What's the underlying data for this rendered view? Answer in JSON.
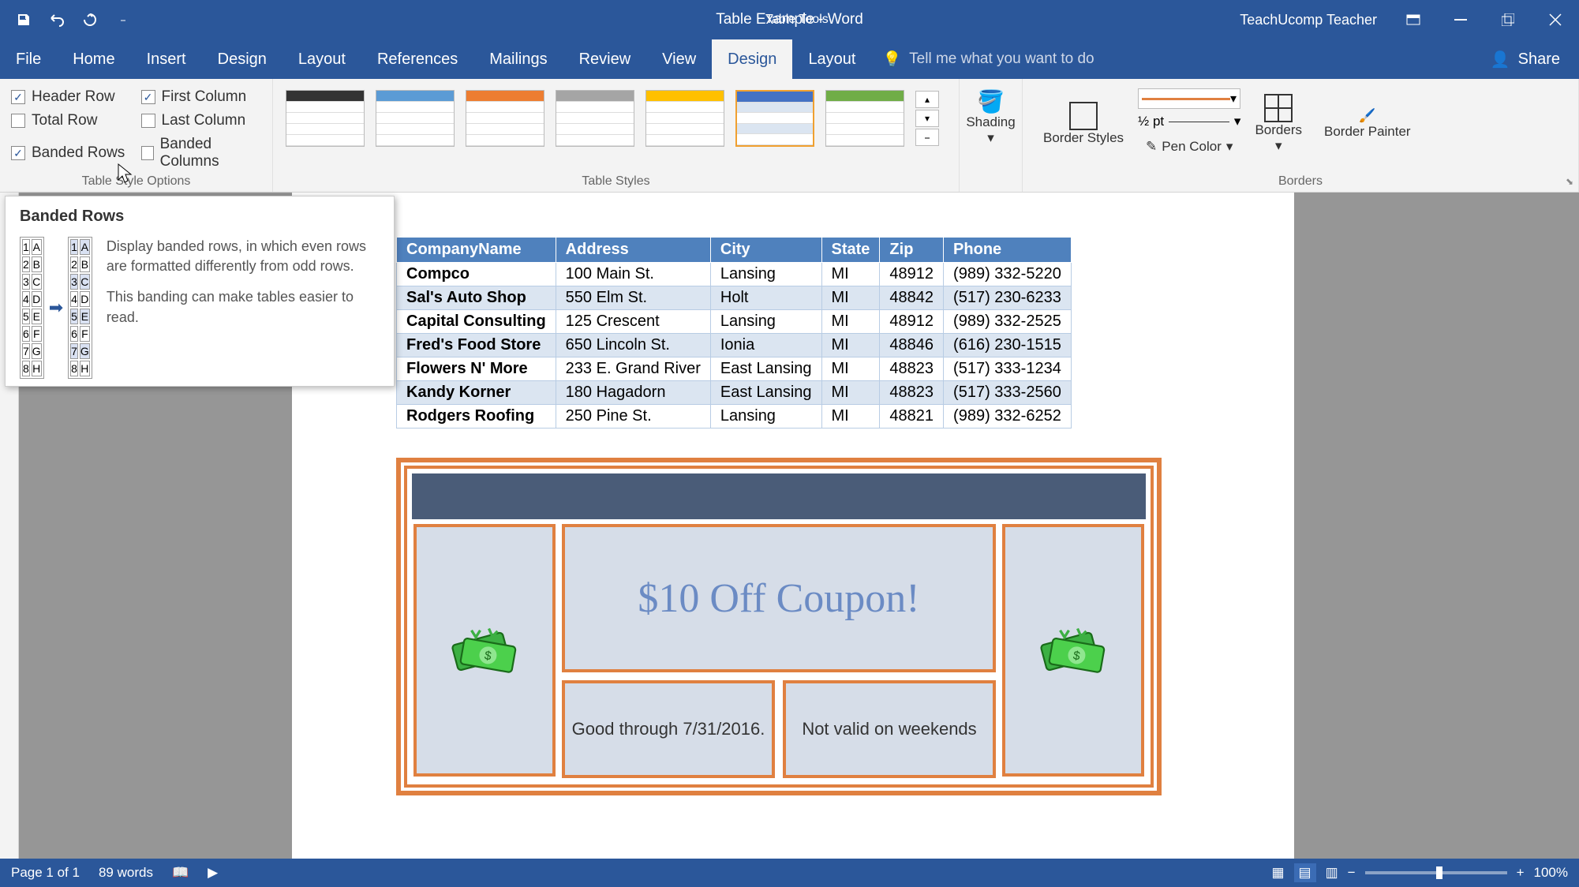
{
  "title_bar": {
    "doc_title": "Table Example - Word",
    "table_tools": "Table Tools",
    "user": "TeachUcomp Teacher"
  },
  "tabs": {
    "file": "File",
    "home": "Home",
    "insert": "Insert",
    "design1": "Design",
    "layout1": "Layout",
    "references": "References",
    "mailings": "Mailings",
    "review": "Review",
    "view": "View",
    "design2": "Design",
    "layout2": "Layout",
    "tell_me": "Tell me what you want to do",
    "share": "Share"
  },
  "ribbon": {
    "style_options": {
      "header_row": "Header Row",
      "first_column": "First Column",
      "total_row": "Total Row",
      "last_column": "Last Column",
      "banded_rows": "Banded Rows",
      "banded_columns": "Banded Columns",
      "group_label": "Table Style Options"
    },
    "table_styles_label": "Table Styles",
    "shading": "Shading",
    "border_styles": "Border Styles",
    "line_weight": "½ pt",
    "pen_color": "Pen Color",
    "borders": "Borders",
    "border_painter": "Border Painter",
    "borders_label": "Borders"
  },
  "tooltip": {
    "title": "Banded Rows",
    "p1": "Display banded rows, in which even rows are formatted differently from odd rows.",
    "p2": "This banding can make tables easier to read."
  },
  "data_table": {
    "headers": [
      "CompanyName",
      "Address",
      "City",
      "State",
      "Zip",
      "Phone"
    ],
    "rows": [
      [
        "Compco",
        "100 Main St.",
        "Lansing",
        "MI",
        "48912",
        "(989) 332-5220"
      ],
      [
        "Sal's Auto Shop",
        "550 Elm St.",
        "Holt",
        "MI",
        "48842",
        "(517) 230-6233"
      ],
      [
        "Capital Consulting",
        "125 Crescent",
        "Lansing",
        "MI",
        "48912",
        "(989) 332-2525"
      ],
      [
        "Fred's Food Store",
        "650 Lincoln St.",
        "Ionia",
        "MI",
        "48846",
        "(616) 230-1515"
      ],
      [
        "Flowers N' More",
        "233 E. Grand River",
        "East Lansing",
        "MI",
        "48823",
        "(517) 333-1234"
      ],
      [
        "Kandy Korner",
        "180 Hagadorn",
        "East Lansing",
        "MI",
        "48823",
        "(517) 333-2560"
      ],
      [
        "Rodgers Roofing",
        "250 Pine St.",
        "Lansing",
        "MI",
        "48821",
        "(989) 332-6252"
      ]
    ]
  },
  "coupon": {
    "title": "$10 Off Coupon!",
    "good_through": "Good through 7/31/2016.",
    "not_valid": "Not valid on weekends"
  },
  "status": {
    "page": "Page 1 of 1",
    "words": "89 words",
    "zoom": "100%"
  }
}
